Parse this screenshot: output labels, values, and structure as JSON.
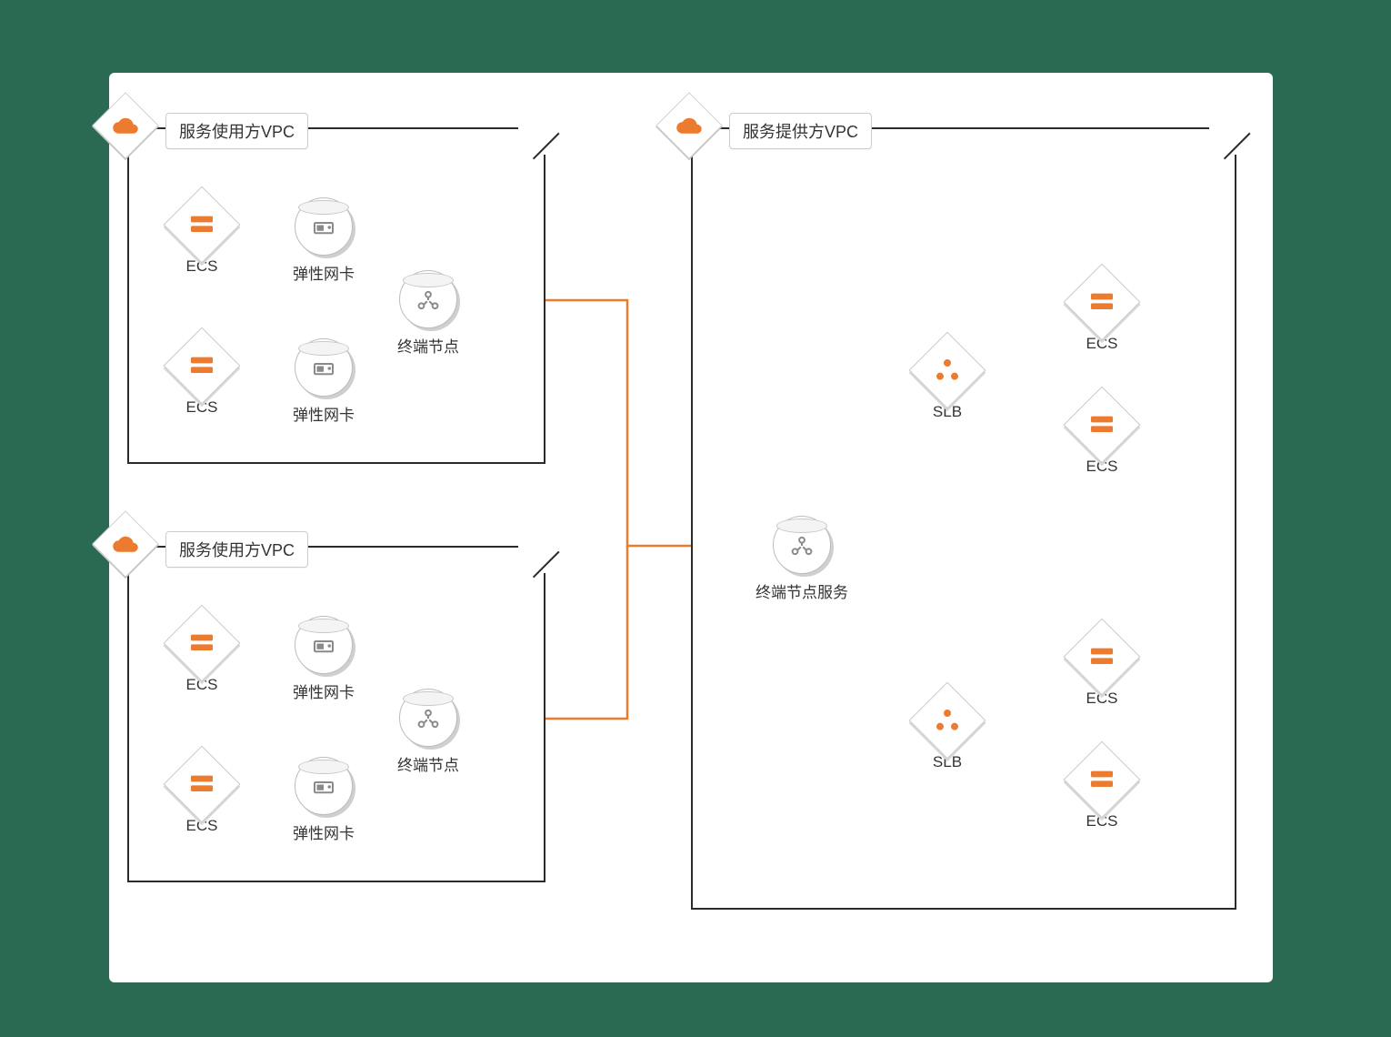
{
  "colors": {
    "accent": "#ed7b2f",
    "stroke": "#2b2b2b",
    "bg_dark": "#2a6a52"
  },
  "vpc_consumer": {
    "title": "服务使用方VPC"
  },
  "vpc_provider": {
    "title": "服务提供方VPC"
  },
  "labels": {
    "ecs": "ECS",
    "eni": "弹性网卡",
    "endpoint": "终端节点",
    "endpoint_service": "终端节点服务",
    "slb": "SLB"
  },
  "icons": {
    "cloud": "cloud-icon",
    "ecs": "server-icon",
    "eni": "nic-icon",
    "endpoint": "hub-icon",
    "slb": "loadbalancer-icon"
  }
}
